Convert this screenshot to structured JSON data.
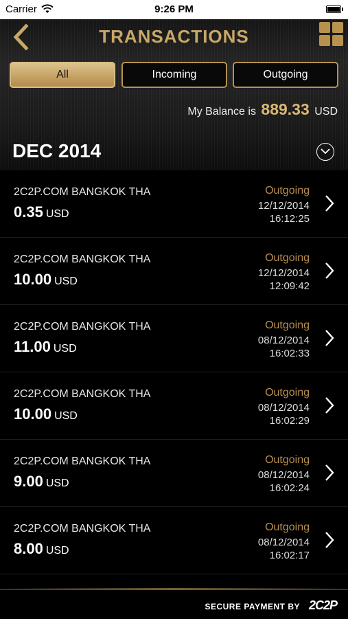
{
  "status_bar": {
    "carrier": "Carrier",
    "time": "9:26 PM"
  },
  "header": {
    "title": "TRANSACTIONS",
    "back_icon": "chevron-left-icon",
    "menu_icon": "grid-icon",
    "accent_color": "#c8a867"
  },
  "tabs": [
    {
      "label": "All",
      "active": true
    },
    {
      "label": "Incoming",
      "active": false
    },
    {
      "label": "Outgoing",
      "active": false
    }
  ],
  "balance": {
    "prefix": "My Balance is",
    "amount": "889.33",
    "currency": "USD"
  },
  "month": {
    "label": "DEC 2014",
    "toggle_icon": "chevron-down-circle-icon"
  },
  "transactions": [
    {
      "merchant": "2C2P.COM BANGKOK THA",
      "amount": "0.35",
      "currency": "USD",
      "direction": "Outgoing",
      "date": "12/12/2014",
      "time": "16:12:25"
    },
    {
      "merchant": "2C2P.COM BANGKOK THA",
      "amount": "10.00",
      "currency": "USD",
      "direction": "Outgoing",
      "date": "12/12/2014",
      "time": "12:09:42"
    },
    {
      "merchant": "2C2P.COM BANGKOK THA",
      "amount": "11.00",
      "currency": "USD",
      "direction": "Outgoing",
      "date": "08/12/2014",
      "time": "16:02:33"
    },
    {
      "merchant": "2C2P.COM BANGKOK THA",
      "amount": "10.00",
      "currency": "USD",
      "direction": "Outgoing",
      "date": "08/12/2014",
      "time": "16:02:29"
    },
    {
      "merchant": "2C2P.COM BANGKOK THA",
      "amount": "9.00",
      "currency": "USD",
      "direction": "Outgoing",
      "date": "08/12/2014",
      "time": "16:02:24"
    },
    {
      "merchant": "2C2P.COM BANGKOK THA",
      "amount": "8.00",
      "currency": "USD",
      "direction": "Outgoing",
      "date": "08/12/2014",
      "time": "16:02:17"
    }
  ],
  "footer": {
    "secure_text": "SECURE PAYMENT BY",
    "brand": "2C2P"
  }
}
